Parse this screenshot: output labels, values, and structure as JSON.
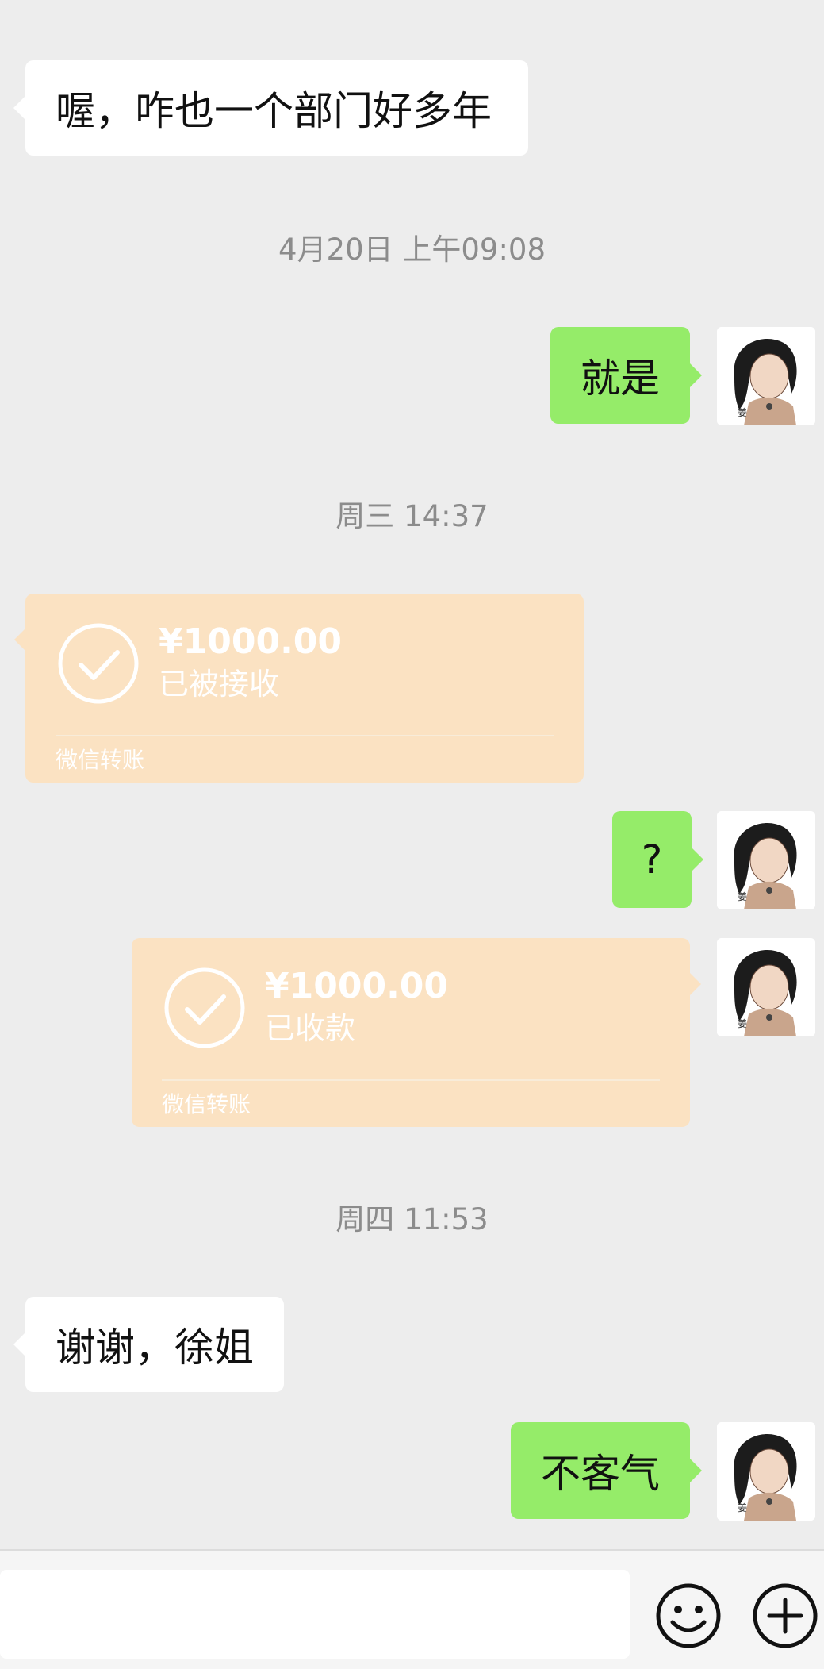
{
  "messages": {
    "m1": "喔，咋也一个部门好多年",
    "ts1": "4月20日 上午09:08",
    "m2": "就是",
    "ts2": "周三 14:37",
    "t1": {
      "amount": "¥1000.00",
      "status": "已被接收",
      "footer": "微信转账"
    },
    "m3": "?",
    "t2": {
      "amount": "¥1000.00",
      "status": "已收款",
      "footer": "微信转账"
    },
    "ts3": "周四 11:53",
    "m4": "谢谢，徐姐",
    "m5": "不客气"
  },
  "colors": {
    "background": "#ededed",
    "incoming_bubble": "#ffffff",
    "outgoing_bubble": "#95ec69",
    "transfer_card": "#fbe2c2",
    "timestamp": "#8c8c8c"
  },
  "bottom_bar": {
    "input_value": "",
    "emoji_icon": "smile-icon",
    "plus_icon": "plus-circle-icon"
  }
}
